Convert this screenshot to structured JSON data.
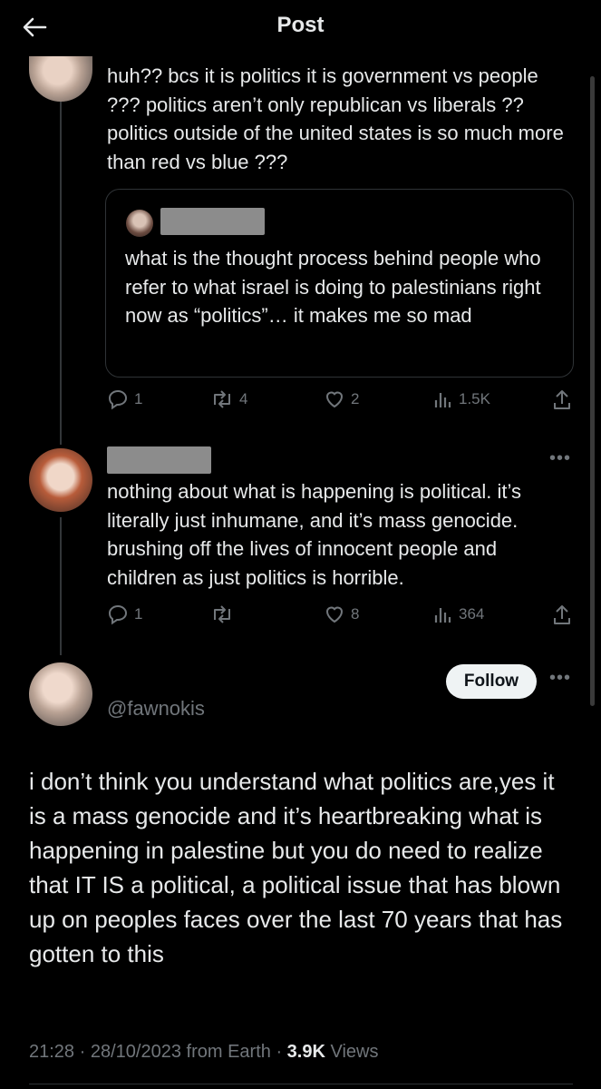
{
  "header": {
    "title": "Post"
  },
  "tweet1": {
    "text": "huh?? bcs it is politics it is government vs people ??? politics aren’t only republican vs liberals ?? politics outside of the united states is so much more than red vs blue ???",
    "quote_text": "what is the thought process behind people who refer to what israel is doing to palestinians right now as “politics”… it makes me so mad",
    "replies": "1",
    "reposts": "4",
    "likes": "2",
    "views": "1.5K"
  },
  "tweet2": {
    "text": "nothing about what is happening is political. it’s literally just inhumane, and it’s mass genocide. brushing off the lives of innocent people and children as just politics is horrible.",
    "replies": "1",
    "reposts": "",
    "likes": "8",
    "views": "364"
  },
  "main_post": {
    "handle": "@fawnokis",
    "follow_label": "Follow",
    "text": "i don’t think you understand what politics are,yes it is a mass genocide and it’s heartbreaking what is happening in palestine but you do need to realize that IT IS a political, a political issue that has blown up on peoples faces over the last 70 years that has gotten to this",
    "time": "21:28",
    "date": "28/10/2023",
    "source": "from Earth",
    "views_count": "3.9K",
    "views_label": "Views"
  },
  "colors": {
    "background": "#000000",
    "text": "#e7e9ea",
    "muted": "#71767b",
    "border": "#2f3336"
  },
  "icons": [
    "back-arrow-icon",
    "reply-icon",
    "repost-icon",
    "like-icon",
    "views-icon",
    "share-icon",
    "more-icon"
  ]
}
